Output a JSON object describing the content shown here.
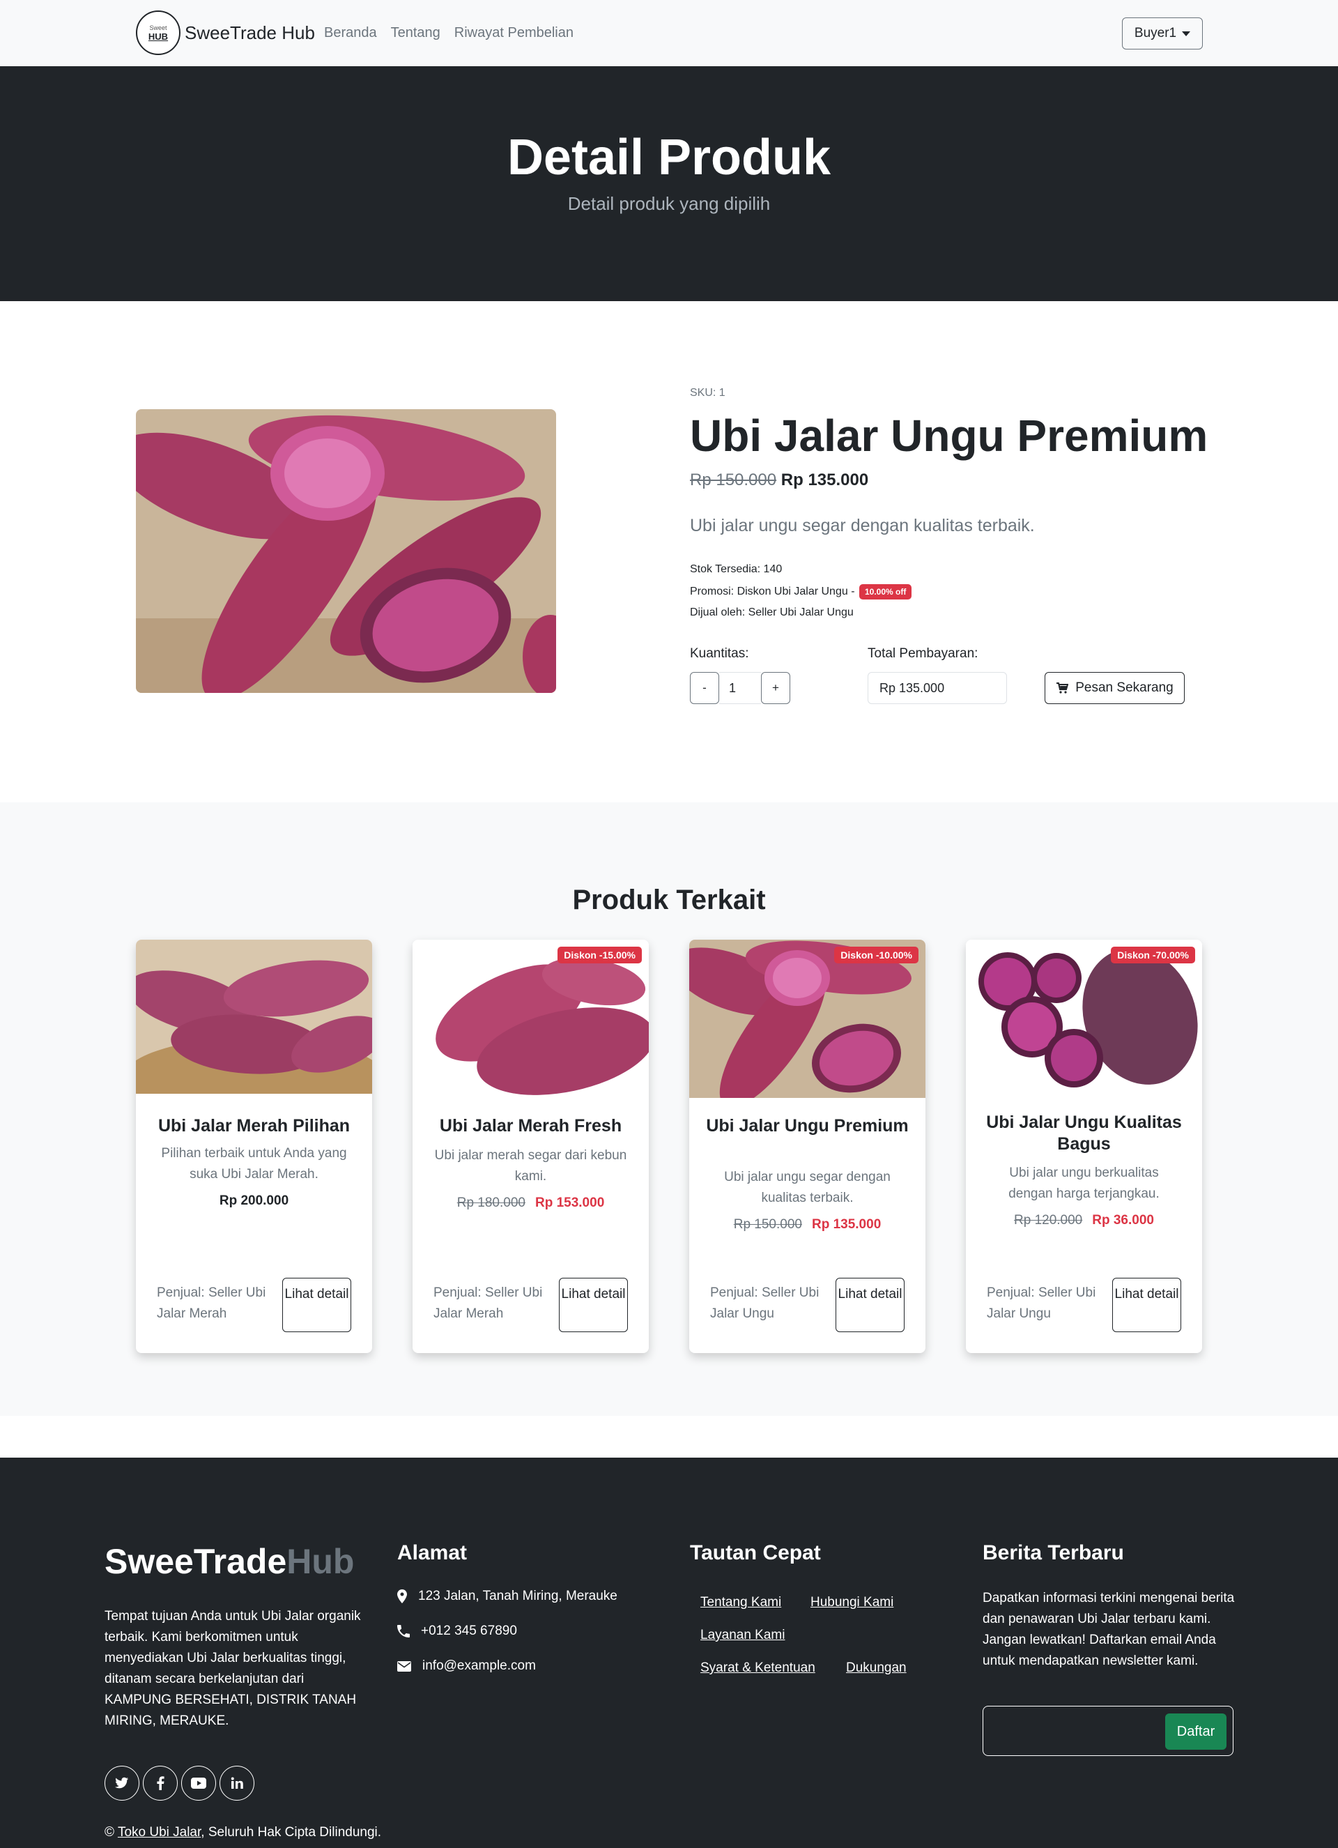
{
  "navbar": {
    "logo_line1": "Sweet",
    "logo_line2": "HUB",
    "brand": "SweeTrade Hub",
    "links": [
      "Beranda",
      "Tentang",
      "Riwayat Pembelian"
    ],
    "user": "Buyer1"
  },
  "hero": {
    "title": "Detail Produk",
    "subtitle": "Detail produk yang dipilih"
  },
  "product": {
    "sku": "SKU: 1",
    "name": "Ubi Jalar Ungu Premium",
    "old_price": "Rp 150.000",
    "price": "Rp 135.000",
    "description": "Ubi jalar ungu segar dengan kualitas terbaik.",
    "stock": "Stok Tersedia: 140",
    "promo_text": "Promosi: Diskon Ubi Jalar Ungu -",
    "promo_badge": "10.00% off",
    "seller": "Dijual oleh: Seller Ubi Jalar Ungu",
    "quantity_label": "Kuantitas:",
    "quantity_minus": "-",
    "quantity_value": "1",
    "quantity_plus": "+",
    "total_label": "Total Pembayaran:",
    "total_value": "Rp 135.000",
    "order_button": "Pesan Sekarang"
  },
  "related": {
    "title": "Produk Terkait",
    "cards": [
      {
        "badge": "",
        "name": "Ubi Jalar Merah Pilihan",
        "desc": "Pilihan terbaik untuk Anda yang suka Ubi Jalar Merah.",
        "old_price": "",
        "price": "Rp 200.000",
        "seller": "Penjual: Seller Ubi Jalar Merah",
        "button": "Lihat detail"
      },
      {
        "badge": "Diskon -15.00%",
        "name": "Ubi Jalar Merah Fresh",
        "desc": "Ubi jalar merah segar dari kebun kami.",
        "old_price": "Rp 180.000",
        "price": "Rp 153.000",
        "seller": "Penjual: Seller Ubi Jalar Merah",
        "button": "Lihat detail"
      },
      {
        "badge": "Diskon -10.00%",
        "name": "Ubi Jalar Ungu Premium",
        "desc": "Ubi jalar ungu segar dengan kualitas terbaik.",
        "old_price": "Rp 150.000",
        "price": "Rp 135.000",
        "seller": "Penjual: Seller Ubi Jalar Ungu",
        "button": "Lihat detail"
      },
      {
        "badge": "Diskon -70.00%",
        "name": "Ubi Jalar Ungu Kualitas Bagus",
        "desc": "Ubi jalar ungu berkualitas dengan harga terjangkau.",
        "old_price": "Rp 120.000",
        "price": "Rp 36.000",
        "seller": "Penjual: Seller Ubi Jalar Ungu",
        "button": "Lihat detail"
      }
    ]
  },
  "footer": {
    "brand_a": "SweeTrade",
    "brand_b": "Hub",
    "about": "Tempat tujuan Anda untuk Ubi Jalar organik terbaik. Kami berkomitmen untuk menyediakan Ubi Jalar berkualitas tinggi, ditanam secara berkelanjutan dari KAMPUNG BERSEHATI, DISTRIK TANAH MIRING, MERAUKE.",
    "address_title": "Alamat",
    "address": "123 Jalan, Tanah Miring, Merauke",
    "phone": "+012 345 67890",
    "email": "info@example.com",
    "links_title": "Tautan Cepat",
    "links": [
      "Tentang Kami",
      "Hubungi Kami",
      "Layanan Kami",
      "Syarat & Ketentuan",
      "Dukungan"
    ],
    "news_title": "Berita Terbaru",
    "news_text": "Dapatkan informasi terkini mengenai berita dan penawaran Ubi Jalar terbaru kami. Jangan lewatkan! Daftarkan email Anda untuk mendapatkan newsletter kami.",
    "subscribe_button": "Daftar",
    "copyright_symbol": "©",
    "copyright_link": "Toko Ubi Jalar",
    "copyright_rest": ", Seluruh Hak Cipta Dilindungi."
  },
  "colors": {
    "dark": "#212529",
    "light": "#f8f9fa",
    "danger": "#dc3545",
    "success": "#198754",
    "muted": "#6c757d"
  }
}
